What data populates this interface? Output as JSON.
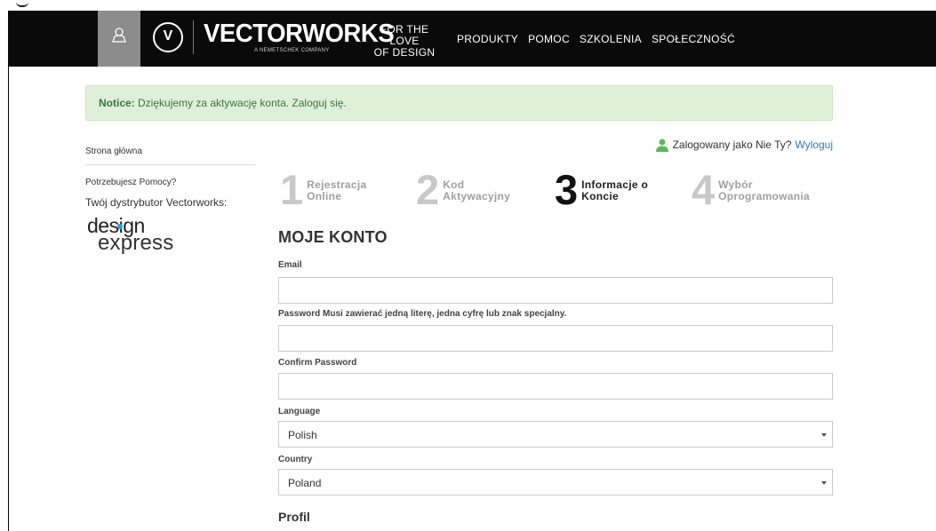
{
  "header": {
    "logo_text": "VECTORWORKS",
    "logo_sub": "A NEMETSCHEK COMPANY",
    "tagline_line1": "FOR THE LOVE",
    "tagline_line2": "OF DESIGN",
    "nav": [
      "PRODUKTY",
      "POMOC",
      "SZKOLENIA",
      "SPOŁECZNOŚĆ"
    ]
  },
  "notice": {
    "label": "Notice:",
    "message": "Dziękujemy za aktywację konta. Zaloguj się."
  },
  "sidebar": {
    "home": "Strona główna",
    "help": "Potrzebujesz Pomocy?",
    "distributor": "Twój dystrybutor Vectorworks:",
    "distributor_logo_line1": "design",
    "distributor_logo_line2": "express"
  },
  "session": {
    "text": "Zalogowany jako Nie Ty?",
    "logout": "Wyloguj"
  },
  "steps": [
    {
      "num": "1",
      "line1": "Rejestracja",
      "line2": "Online",
      "active": false
    },
    {
      "num": "2",
      "line1": "Kod",
      "line2": "Aktywacyjny",
      "active": false
    },
    {
      "num": "3",
      "line1": "Informacje o",
      "line2": "Koncie",
      "active": true
    },
    {
      "num": "4",
      "line1": "Wybór",
      "line2": "Oprogramowania",
      "active": false
    }
  ],
  "form": {
    "title": "MOJE KONTO",
    "email_label": "Email",
    "email_value": "",
    "password_label": "Password Musi zawierać jedną literę, jedna cyfrę lub znak specjalny.",
    "password_value": "",
    "confirm_label": "Confirm Password",
    "confirm_value": "",
    "language_label": "Language",
    "language_value": "Polish",
    "country_label": "Country",
    "country_value": "Poland",
    "profile_heading": "Profil"
  },
  "colors": {
    "header_bg": "#0a0a0a",
    "notice_bg": "#dff0d8",
    "link": "#2a7fc0",
    "user_icon_green": "#5cb85c"
  }
}
